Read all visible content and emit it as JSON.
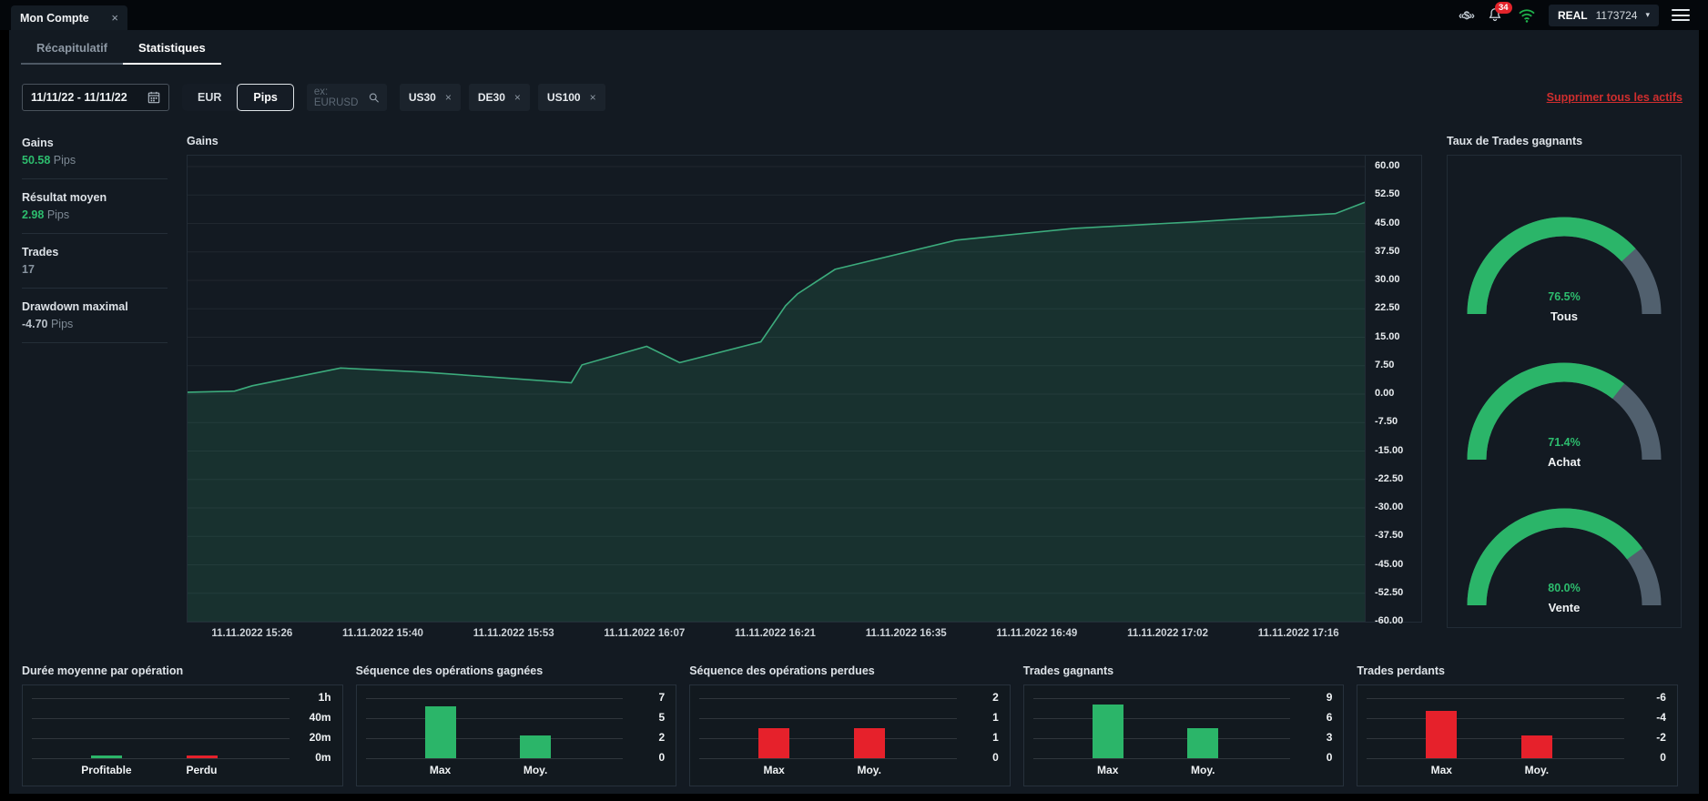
{
  "topbar": {
    "tab_title": "Mon Compte",
    "close_glyph": "×",
    "deposit_glyph": "«$»",
    "badge_count": "34",
    "account_type": "REAL",
    "account_number": "1173724",
    "caret_glyph": "▾"
  },
  "tabs": {
    "recap": "Récapitulatif",
    "stats": "Statistiques"
  },
  "filters": {
    "date_range": "11/11/22 - 11/11/22",
    "currency_option": "EUR",
    "unit_option": "Pips",
    "search_placeholder": "ex: EURUSD",
    "tags": [
      "US30",
      "DE30",
      "US100"
    ],
    "tag_close_glyph": "×",
    "clear_link": "Supprimer tous les actifs"
  },
  "sidebar_stats": [
    {
      "label": "Gains",
      "value": "50.58",
      "unit": "Pips",
      "tone": "green"
    },
    {
      "label": "Résultat moyen",
      "value": "2.98",
      "unit": "Pips",
      "tone": "green"
    },
    {
      "label": "Trades",
      "value": "17",
      "unit": "",
      "tone": "muted"
    },
    {
      "label": "Drawdown maximal",
      "value": "-4.70",
      "unit": "Pips",
      "tone": "light"
    }
  ],
  "colors": {
    "green": "#2bb569",
    "red": "#e6212b",
    "slate": "#51606e",
    "line": "#3cab7c",
    "fill": "rgba(54,179,126,0.15)",
    "wifi": "#1fb24c",
    "badge": "#e3242b"
  },
  "chart_data": [
    {
      "type": "area",
      "title": "Gains",
      "ylabel": "Pips",
      "ylim": [
        -60,
        60
      ],
      "y_tick_step": 7.5,
      "grid": true,
      "x_labels": [
        "11.11.2022 15:26",
        "11.11.2022 15:40",
        "11.11.2022 15:53",
        "11.11.2022 16:07",
        "11.11.2022 16:21",
        "11.11.2022 16:35",
        "11.11.2022 16:49",
        "11.11.2022 17:02",
        "11.11.2022 17:16"
      ],
      "points": [
        [
          0,
          0.5
        ],
        [
          0.04,
          0.8
        ],
        [
          0.055,
          2.2
        ],
        [
          0.13,
          6.9
        ],
        [
          0.2,
          5.8
        ],
        [
          0.326,
          3.0
        ],
        [
          0.335,
          7.7
        ],
        [
          0.39,
          12.6
        ],
        [
          0.418,
          8.3
        ],
        [
          0.487,
          13.8
        ],
        [
          0.508,
          23.3
        ],
        [
          0.518,
          26.4
        ],
        [
          0.55,
          32.9
        ],
        [
          0.653,
          40.6
        ],
        [
          0.753,
          43.7
        ],
        [
          0.86,
          45.5
        ],
        [
          0.9,
          46.3
        ],
        [
          0.975,
          47.6
        ],
        [
          1,
          50.58
        ]
      ]
    },
    {
      "type": "gauge",
      "title": "Taux de Trades gagnants",
      "unit": "%",
      "gauges": [
        {
          "label": "Tous",
          "value": 76.5
        },
        {
          "label": "Achat",
          "value": 71.4
        },
        {
          "label": "Vente",
          "value": 80.0
        }
      ]
    },
    {
      "type": "bar",
      "title": "Durée moyenne par opération",
      "categories": [
        "Profitable",
        "Perdu"
      ],
      "values": [
        2,
        2
      ],
      "value_unit": "minutes",
      "ticks": [
        "1h",
        "40m",
        "20m",
        "0m"
      ],
      "tick_top": 60,
      "bar_colors": [
        "#2bb569",
        "#e6212b"
      ]
    },
    {
      "type": "bar",
      "title": "Séquence des opérations gagnées",
      "categories": [
        "Max",
        "Moy."
      ],
      "values": [
        6,
        2.6
      ],
      "ticks": [
        "7",
        "5",
        "2",
        "0"
      ],
      "tick_top": 7,
      "bar_colors": [
        "#2bb569",
        "#2bb569"
      ]
    },
    {
      "type": "bar",
      "title": "Séquence des opérations perdues",
      "categories": [
        "Max",
        "Moy."
      ],
      "values": [
        1,
        1
      ],
      "ticks": [
        "2",
        "1",
        "1",
        "0"
      ],
      "tick_top": 2,
      "bar_colors": [
        "#e6212b",
        "#e6212b"
      ]
    },
    {
      "type": "bar",
      "title": "Trades gagnants",
      "categories": [
        "Max",
        "Moy."
      ],
      "values": [
        8,
        4.5
      ],
      "ticks": [
        "9",
        "6",
        "3",
        "0"
      ],
      "tick_top": 9,
      "bar_colors": [
        "#2bb569",
        "#2bb569"
      ]
    },
    {
      "type": "bar",
      "title": "Trades perdants",
      "categories": [
        "Max",
        "Moy."
      ],
      "values": [
        -4.7,
        -2.3
      ],
      "ticks": [
        "-6",
        "-4",
        "-2",
        "0"
      ],
      "tick_top": -6,
      "bar_colors": [
        "#e6212b",
        "#e6212b"
      ]
    }
  ]
}
